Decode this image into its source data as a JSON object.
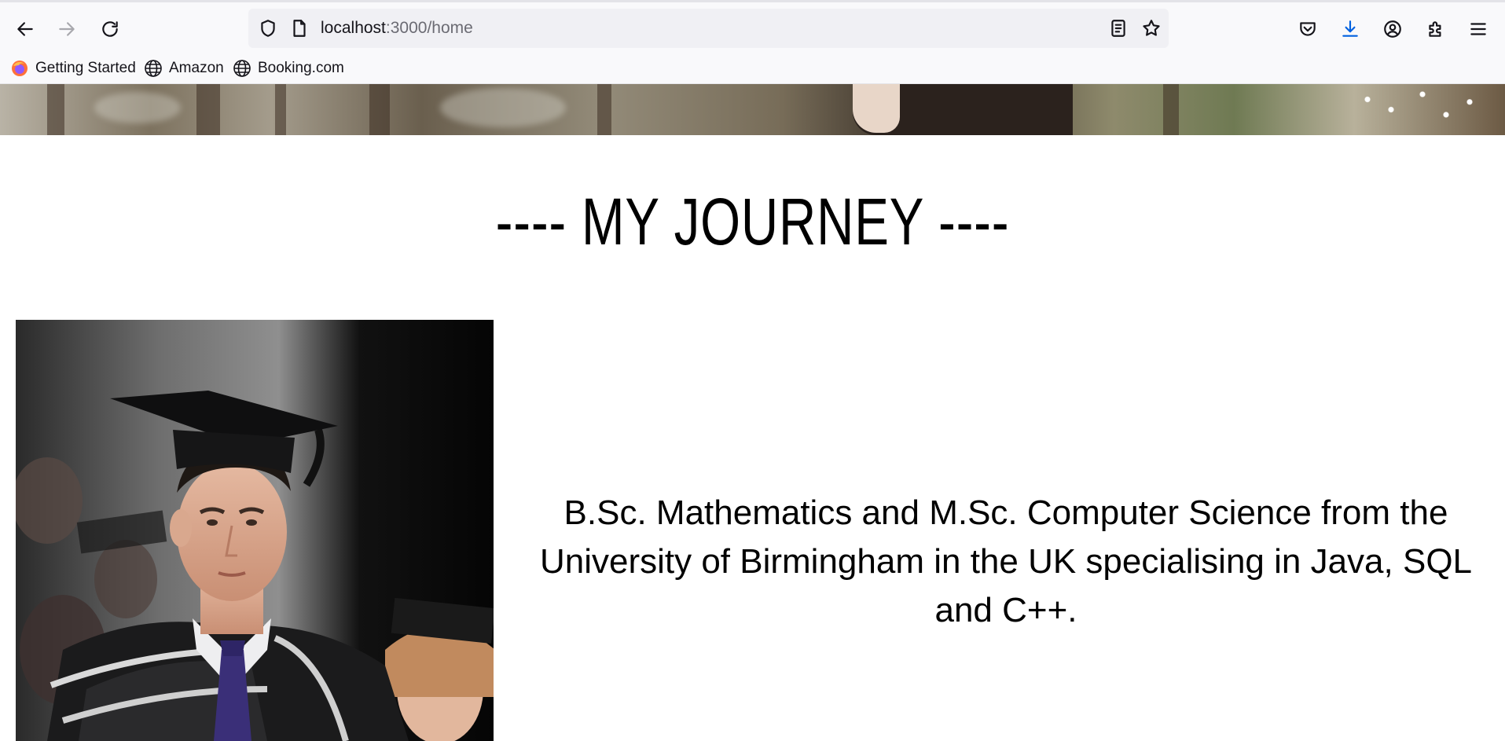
{
  "browser": {
    "url_host": "localhost",
    "url_path": ":3000/home",
    "bookmarks": [
      {
        "label": "Getting Started",
        "icon": "firefox-icon"
      },
      {
        "label": "Amazon",
        "icon": "globe-icon"
      },
      {
        "label": "Booking.com",
        "icon": "globe-icon"
      }
    ],
    "colors": {
      "accent_download": "#0061e0",
      "chrome_bg": "#f9f9fb",
      "urlbar_bg": "#f0f0f4"
    }
  },
  "page": {
    "heading": "---- MY JOURNEY ----",
    "description": "B.Sc. Mathematics and M.Sc. Computer Science from the University of Birmingham in the UK specialising in Java, SQL and C++."
  }
}
